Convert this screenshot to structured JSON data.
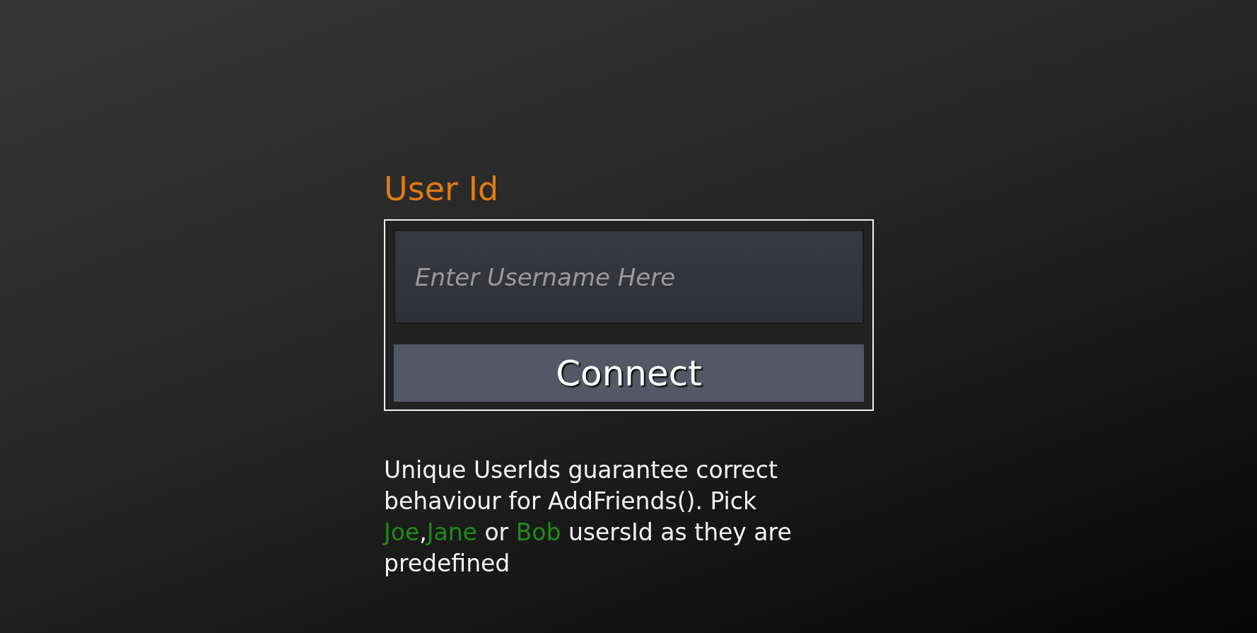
{
  "login": {
    "label": "User Id",
    "username": {
      "placeholder": "Enter Username Here"
    },
    "connect_button": "Connect"
  },
  "help_text": [
    {
      "text": "Unique UserIds guarantee correct behaviour for AddFriends(). Pick ",
      "highlight": false
    },
    {
      "text": "Joe",
      "highlight": true
    },
    {
      "text": ",",
      "highlight": false
    },
    {
      "text": "Jane",
      "highlight": true
    },
    {
      "text": " or ",
      "highlight": false
    },
    {
      "text": "Bob",
      "highlight": true
    },
    {
      "text": " usersId as they are predefined",
      "highlight": false
    }
  ]
}
